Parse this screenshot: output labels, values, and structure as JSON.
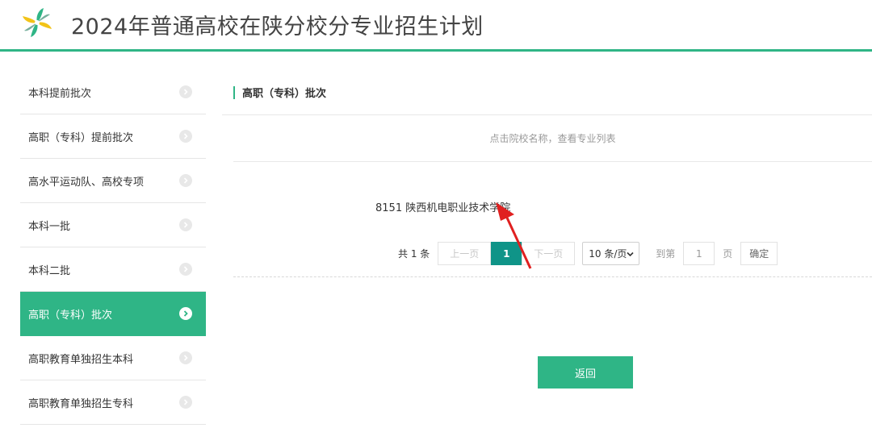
{
  "header": {
    "title": "2024年普通高校在陕分校分专业招生计划",
    "logo_icon": "pinwheel-logo-icon",
    "accent": "#2fb586"
  },
  "sidebar": {
    "items": [
      {
        "label": "本科提前批次",
        "active": false
      },
      {
        "label": "高职（专科）提前批次",
        "active": false
      },
      {
        "label": "高水平运动队、高校专项",
        "active": false
      },
      {
        "label": "本科一批",
        "active": false
      },
      {
        "label": "本科二批",
        "active": false
      },
      {
        "label": "高职（专科）批次",
        "active": true
      },
      {
        "label": "高职教育单独招生本科",
        "active": false
      },
      {
        "label": "高职教育单独招生专科",
        "active": false
      }
    ]
  },
  "main": {
    "section_title": "高职（专科）批次",
    "hint": "点击院校名称，查看专业列表",
    "school": "8151 陕西机电职业技术学院",
    "pagination": {
      "total": "共 1 条",
      "prev": "上一页",
      "current": "1",
      "next": "下一页",
      "page_size": "10 条/页",
      "goto_label": "到第",
      "goto_value": "1",
      "page_unit": "页",
      "confirm": "确定"
    },
    "back_button": "返回"
  },
  "annotation": {
    "color": "#e02020"
  }
}
